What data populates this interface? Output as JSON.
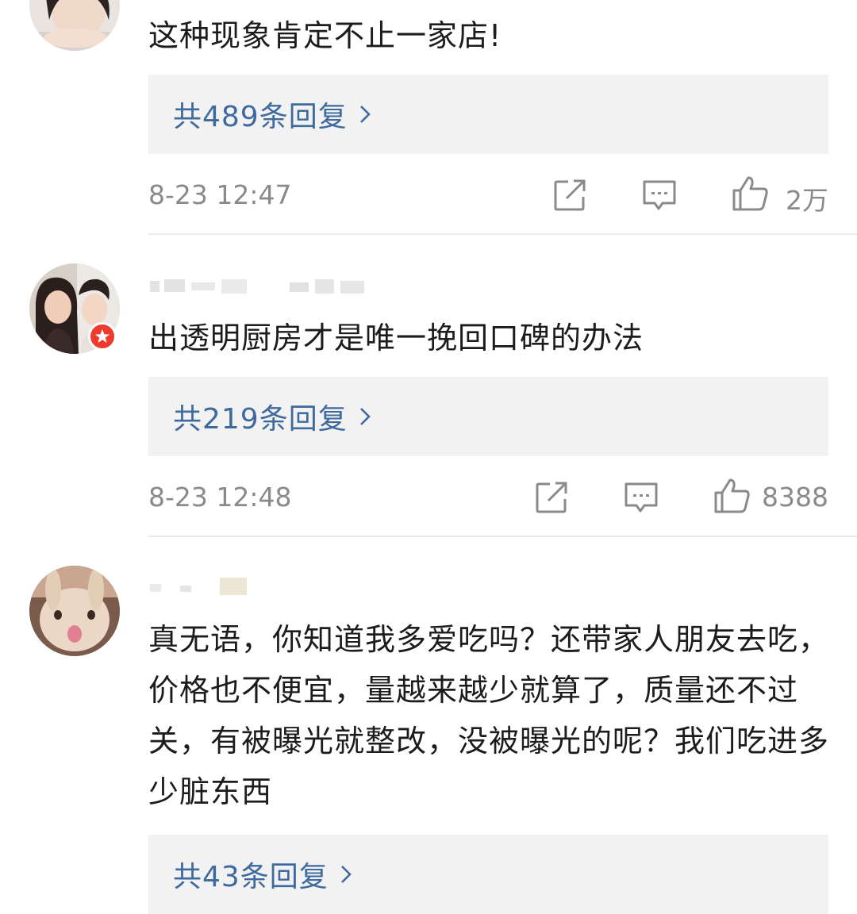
{
  "comments": [
    {
      "username": "",
      "text": "这种现象肯定不止一家店!",
      "reply_label": "共489条回复",
      "time": "8-23 12:47",
      "like_count": "2万"
    },
    {
      "username": "",
      "text": "出透明厨房才是唯一挽回口碑的办法",
      "reply_label": "共219条回复",
      "time": "8-23 12:48",
      "like_count": "8388"
    },
    {
      "username": "",
      "text": "真无语，你知道我多爱吃吗？还带家人朋友去吃，价格也不便宜，量越来越少就算了，质量还不过关，有被曝光就整改，没被曝光的呢？我们吃进多少脏东西",
      "reply_label": "共43条回复"
    }
  ],
  "colors": {
    "reply_link": "#3e6a9e",
    "reply_bg": "#f2f2f2",
    "meta_text": "#8a8a8a",
    "badge": "#ef3b2d"
  },
  "icons": [
    "share-icon",
    "comment-icon",
    "like-icon",
    "chevron-right-icon",
    "verified-badge-icon"
  ]
}
